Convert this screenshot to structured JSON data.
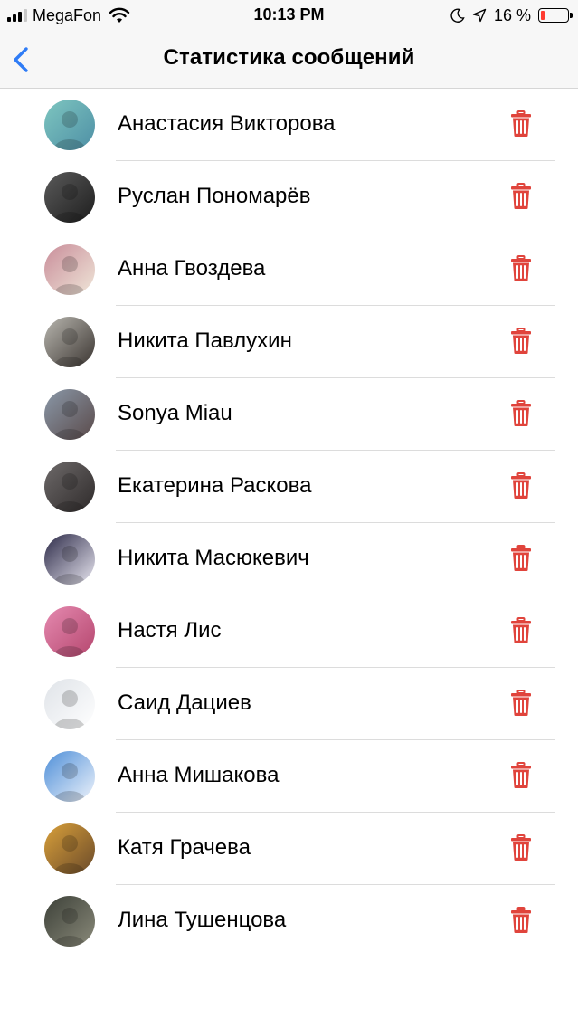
{
  "status_bar": {
    "carrier": "MegaFon",
    "time": "10:13 PM",
    "battery_text": "16 %",
    "battery_level": 0.16,
    "battery_color": "#ff3b30",
    "icons": [
      "signal-icon",
      "wifi-icon",
      "moon-icon",
      "location-arrow-icon",
      "battery-icon"
    ]
  },
  "nav": {
    "title": "Статистика сообщений",
    "back_icon": "chevron-left-icon",
    "accent": "#2f7cf6"
  },
  "delete_color": "#e0443c",
  "contacts": [
    {
      "name": "Анастасия Викторова",
      "avatar_colors": [
        "#7ec6c0",
        "#4e8fa5"
      ]
    },
    {
      "name": "Руслан Пономарёв",
      "avatar_colors": [
        "#5a5a5a",
        "#1e1e1e"
      ]
    },
    {
      "name": "Анна Гвоздева",
      "avatar_colors": [
        "#c98d9a",
        "#efe6d8"
      ]
    },
    {
      "name": "Никита Павлухин",
      "avatar_colors": [
        "#b9b7b0",
        "#3a3430"
      ]
    },
    {
      "name": "Sonya Miau",
      "avatar_colors": [
        "#8a98a8",
        "#5a4a4a"
      ]
    },
    {
      "name": "Екатерина Раскова",
      "avatar_colors": [
        "#6e6a6a",
        "#2e2a2a"
      ]
    },
    {
      "name": "Никита Масюкевич",
      "avatar_colors": [
        "#2c2a48",
        "#e8e6f0"
      ]
    },
    {
      "name": "Настя Лис",
      "avatar_colors": [
        "#e58ab0",
        "#b5466e"
      ]
    },
    {
      "name": "Саид Дациев",
      "avatar_colors": [
        "#dfe3e8",
        "#ffffff"
      ]
    },
    {
      "name": "Анна Мишакова",
      "avatar_colors": [
        "#4f8fd8",
        "#eef3fb"
      ]
    },
    {
      "name": "Катя Грачева",
      "avatar_colors": [
        "#d9a03a",
        "#6a4a2a"
      ]
    },
    {
      "name": "Лина Тушенцова",
      "avatar_colors": [
        "#3c4038",
        "#8a8a7a"
      ]
    }
  ]
}
